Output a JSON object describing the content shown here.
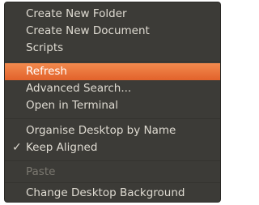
{
  "menu": {
    "items": [
      {
        "label": "Create New Folder"
      },
      {
        "label": "Create New Document"
      },
      {
        "label": "Scripts"
      },
      {
        "label": "Refresh"
      },
      {
        "label": "Advanced Search..."
      },
      {
        "label": "Open in Terminal"
      },
      {
        "label": "Organise Desktop by Name"
      },
      {
        "label": "Keep Aligned",
        "check_mark": "✓"
      },
      {
        "label": "Paste"
      },
      {
        "label": "Change Desktop Background"
      }
    ],
    "colors": {
      "background": "#3c3b37",
      "text": "#dfdbd2",
      "highlight": "#e9703a",
      "disabled_text": "#7b7870"
    }
  }
}
